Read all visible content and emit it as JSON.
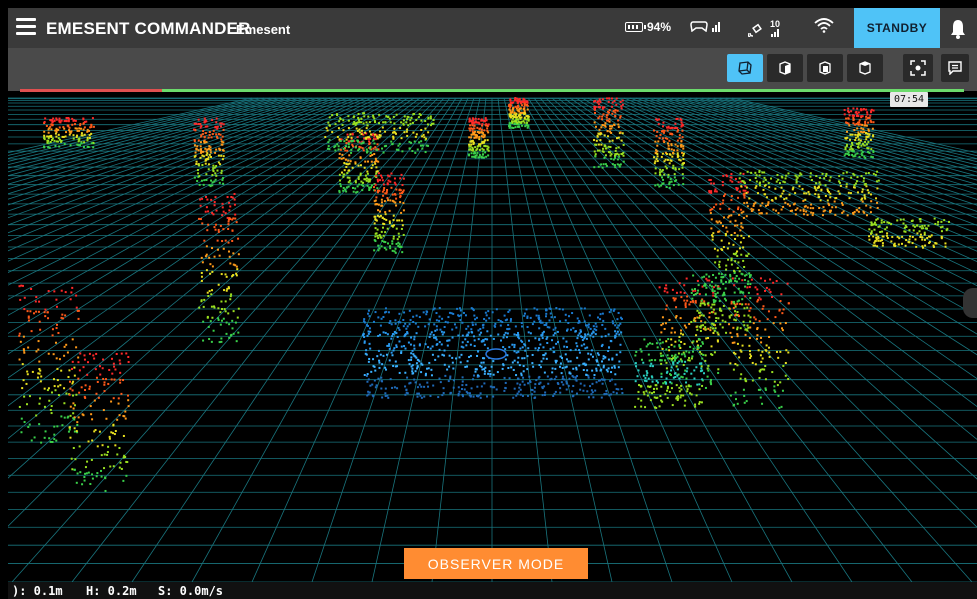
{
  "header": {
    "title": "EMESENT COMMANDER",
    "subtitle": "Emesent",
    "battery_text": "94%",
    "satellite_count": "10",
    "standby_label": "STANDBY"
  },
  "toolbar": {
    "view_icons": [
      "perspective-view-icon",
      "front-view-icon",
      "side-view-icon",
      "top-view-icon",
      "fit-view-icon",
      "message-icon"
    ]
  },
  "mission": {
    "timer": "07:54",
    "progress": 0.15
  },
  "observer_label": "OBSERVER MODE",
  "bottom": {
    "d": "): 0.1m",
    "h": "H: 0.2m",
    "s": "S: 0.0m/s"
  },
  "colors": {
    "accent": "#4fc3f7",
    "observer": "#ff8c32",
    "grid": "#1e8a95",
    "progress_done": "#e05050",
    "progress_remaining": "#6cdb6c"
  }
}
